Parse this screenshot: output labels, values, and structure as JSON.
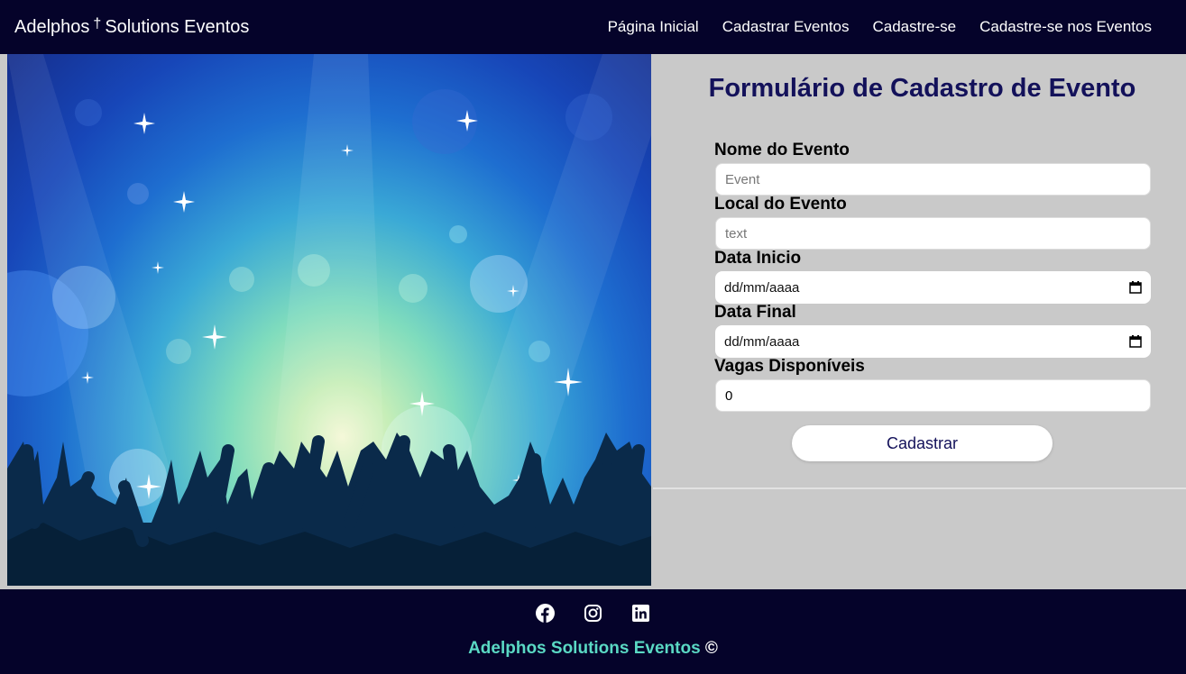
{
  "navbar": {
    "brand_name": "Adelphos",
    "brand_cross": "†",
    "brand_rest": "Solutions Eventos",
    "links": [
      "Página Inicial",
      "Cadastrar Eventos",
      "Cadastre-se",
      "Cadastre-se nos Eventos"
    ]
  },
  "form": {
    "title": "Formulário de Cadastro de Evento",
    "fields": [
      {
        "label": "Nome do Evento",
        "placeholder": "Event",
        "value": ""
      },
      {
        "label": "Local do Evento",
        "placeholder": "text",
        "value": ""
      },
      {
        "label": "Data Inicio",
        "display": "dd/mm/aaaa"
      },
      {
        "label": "Data Final",
        "display": "dd/mm/aaaa"
      },
      {
        "label": "Vagas Disponíveis",
        "value": "0"
      }
    ],
    "submit_label": "Cadastrar"
  },
  "footer": {
    "social_icons": [
      "facebook-icon",
      "instagram-icon",
      "linkedin-icon"
    ],
    "brand": "Adelphos Solutions Eventos",
    "copyright": "©"
  },
  "colors": {
    "navbar_bg": "#05032a",
    "title": "#13115a",
    "footer_brand": "#5ad9c4",
    "panel_bg": "#c9c9c9"
  }
}
